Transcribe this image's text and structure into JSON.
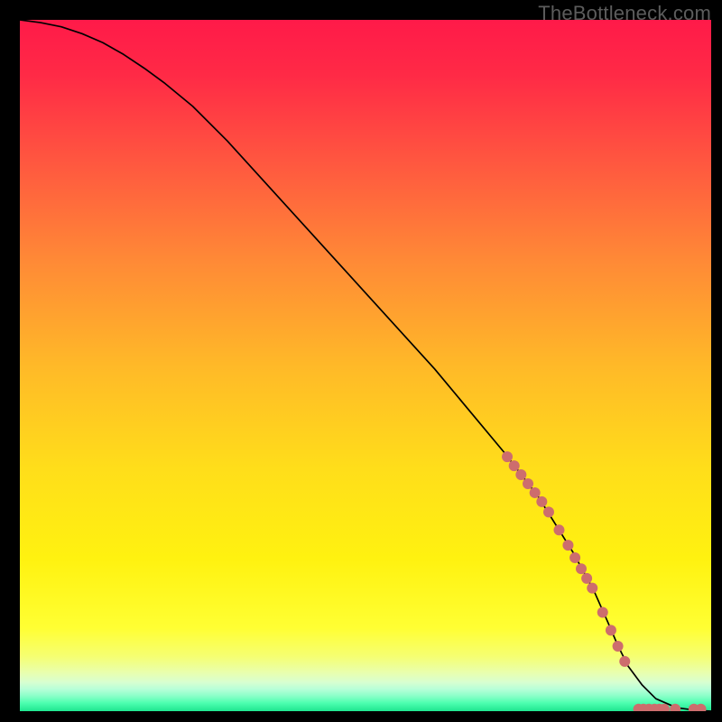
{
  "watermark": "TheBottleneck.com",
  "chart_data": {
    "type": "line",
    "title": "",
    "xlabel": "",
    "ylabel": "",
    "xlim": [
      0,
      100
    ],
    "ylim": [
      0,
      100
    ],
    "curve": {
      "name": "bottleneck-curve",
      "x": [
        0,
        3,
        6,
        9,
        12,
        15,
        18,
        21,
        25,
        30,
        35,
        40,
        45,
        50,
        55,
        60,
        65,
        70,
        75,
        80,
        83,
        85,
        86.5,
        88,
        90,
        92,
        95,
        98,
        100
      ],
      "y": [
        100,
        99.6,
        99,
        98,
        96.7,
        95,
        93,
        90.8,
        87.5,
        82.5,
        77,
        71.5,
        66,
        60.5,
        55,
        49.5,
        43.5,
        37.5,
        31,
        23,
        17.5,
        13,
        9.5,
        6.5,
        3.8,
        1.8,
        0.5,
        0.1,
        0
      ],
      "color": "#000000",
      "width": 1.7
    },
    "markers": {
      "name": "sample-points",
      "color": "#cd6d6d",
      "radius": 6,
      "points": [
        {
          "x": 70.5,
          "y": 36.8
        },
        {
          "x": 71.5,
          "y": 35.5
        },
        {
          "x": 72.5,
          "y": 34.2
        },
        {
          "x": 73.5,
          "y": 32.9
        },
        {
          "x": 74.5,
          "y": 31.6
        },
        {
          "x": 75.5,
          "y": 30.3
        },
        {
          "x": 76.5,
          "y": 28.8
        },
        {
          "x": 78.0,
          "y": 26.2
        },
        {
          "x": 79.3,
          "y": 24.0
        },
        {
          "x": 80.3,
          "y": 22.2
        },
        {
          "x": 81.2,
          "y": 20.6
        },
        {
          "x": 82.0,
          "y": 19.2
        },
        {
          "x": 82.8,
          "y": 17.8
        },
        {
          "x": 84.3,
          "y": 14.3
        },
        {
          "x": 85.5,
          "y": 11.7
        },
        {
          "x": 86.5,
          "y": 9.4
        },
        {
          "x": 87.5,
          "y": 7.2
        },
        {
          "x": 89.5,
          "y": 0.3
        },
        {
          "x": 90.2,
          "y": 0.3
        },
        {
          "x": 91.0,
          "y": 0.3
        },
        {
          "x": 91.8,
          "y": 0.3
        },
        {
          "x": 92.5,
          "y": 0.3
        },
        {
          "x": 93.2,
          "y": 0.3
        },
        {
          "x": 94.8,
          "y": 0.3
        },
        {
          "x": 97.5,
          "y": 0.3
        },
        {
          "x": 98.5,
          "y": 0.3
        }
      ]
    },
    "gradient_stops": [
      {
        "offset": 0.0,
        "color": "#ff1a49"
      },
      {
        "offset": 0.08,
        "color": "#ff2a46"
      },
      {
        "offset": 0.2,
        "color": "#ff5540"
      },
      {
        "offset": 0.35,
        "color": "#ff8a36"
      },
      {
        "offset": 0.5,
        "color": "#ffb928"
      },
      {
        "offset": 0.65,
        "color": "#ffde1a"
      },
      {
        "offset": 0.78,
        "color": "#fff210"
      },
      {
        "offset": 0.88,
        "color": "#ffff33"
      },
      {
        "offset": 0.92,
        "color": "#f6ff70"
      },
      {
        "offset": 0.945,
        "color": "#e8ffb0"
      },
      {
        "offset": 0.958,
        "color": "#d8ffd0"
      },
      {
        "offset": 0.968,
        "color": "#b8ffd8"
      },
      {
        "offset": 0.978,
        "color": "#8affc8"
      },
      {
        "offset": 0.988,
        "color": "#4effb0"
      },
      {
        "offset": 1.0,
        "color": "#1fe690"
      }
    ]
  }
}
